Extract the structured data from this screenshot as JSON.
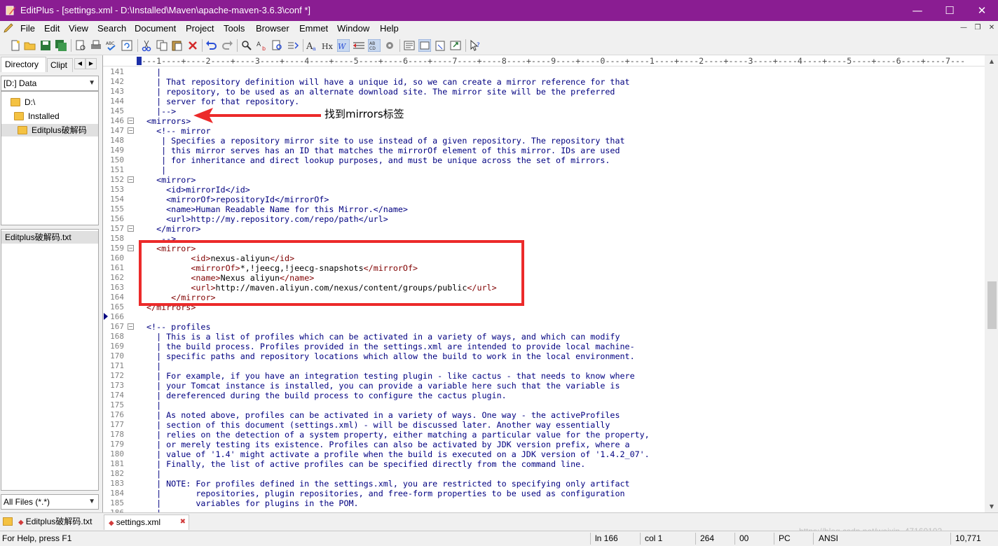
{
  "window": {
    "title": "EditPlus - [settings.xml - D:\\Installed\\Maven\\apache-maven-3.6.3\\conf *]",
    "minimize": "—",
    "maximize": "☐",
    "close": "✕"
  },
  "menu": [
    "File",
    "Edit",
    "View",
    "Search",
    "Document",
    "Project",
    "Tools",
    "Browser",
    "Emmet",
    "Window",
    "Help"
  ],
  "toolbar_icons": [
    "new-file-icon",
    "open-folder-icon",
    "save-icon",
    "save-all-icon",
    "print-preview-icon",
    "print-icon",
    "spell-check-icon",
    "refresh-icon",
    "cut-icon",
    "copy-icon",
    "paste-icon",
    "delete-icon",
    "undo-icon",
    "redo-icon",
    "find-icon",
    "replace-icon",
    "find-in-files-icon",
    "go-to-icon",
    "font-icon",
    "heading-icon",
    "word-wrap-icon",
    "ruler-icon",
    "line-number-icon",
    "settings-icon",
    "view-icon",
    "browser-icon",
    "clipboard-icon",
    "export-icon",
    "help-icon"
  ],
  "sidebar": {
    "tabs": [
      "Directory",
      "Clipt"
    ],
    "drive": "[D:] Data",
    "tree": [
      "D:\\",
      "Installed",
      "Editplus破解码"
    ],
    "files": [
      "Editplus破解码.txt"
    ],
    "filter": "All Files (*.*)"
  },
  "ruler": "+---1----+----2----+----3----+----4----+----5----+----6----+----7----+----8----+----9----+----0----+----1----+----2----+----3----+----4----+----5----+----6----+----7---",
  "code_lines": [
    {
      "n": "141",
      "parts": [
        [
          "t",
          "  |"
        ]
      ]
    },
    {
      "n": "142",
      "parts": [
        [
          "t",
          "  | That repository definition will have a unique id, so we can create a mirror reference for that"
        ]
      ]
    },
    {
      "n": "143",
      "parts": [
        [
          "t",
          "  | repository, to be used as an alternate download site. The mirror site will be the preferred"
        ]
      ]
    },
    {
      "n": "144",
      "parts": [
        [
          "t",
          "  | server for that repository."
        ]
      ]
    },
    {
      "n": "145",
      "parts": [
        [
          "t",
          "  |-->"
        ]
      ]
    },
    {
      "n": "146",
      "fold": true,
      "parts": [
        [
          "t",
          "<mirrors>"
        ]
      ]
    },
    {
      "n": "147",
      "fold": true,
      "parts": [
        [
          "t",
          "  <!-- mirror"
        ]
      ]
    },
    {
      "n": "148",
      "parts": [
        [
          "t",
          "   | Specifies a repository mirror site to use instead of a given repository. The repository that"
        ]
      ]
    },
    {
      "n": "149",
      "parts": [
        [
          "t",
          "   | this mirror serves has an ID that matches the mirrorOf element of this mirror. IDs are used"
        ]
      ]
    },
    {
      "n": "150",
      "parts": [
        [
          "t",
          "   | for inheritance and direct lookup purposes, and must be unique across the set of mirrors."
        ]
      ]
    },
    {
      "n": "151",
      "parts": [
        [
          "t",
          "   |"
        ]
      ]
    },
    {
      "n": "152",
      "fold": true,
      "parts": [
        [
          "t",
          "  <mirror>"
        ]
      ]
    },
    {
      "n": "153",
      "parts": [
        [
          "t",
          "    <id>mirrorId</id>"
        ]
      ]
    },
    {
      "n": "154",
      "parts": [
        [
          "t",
          "    <mirrorOf>repositoryId</mirrorOf>"
        ]
      ]
    },
    {
      "n": "155",
      "parts": [
        [
          "t",
          "    <name>Human Readable Name for this Mirror.</name>"
        ]
      ]
    },
    {
      "n": "156",
      "parts": [
        [
          "t",
          "    <url>http://my.repository.com/repo/path</url>"
        ]
      ]
    },
    {
      "n": "157",
      "fold": true,
      "parts": [
        [
          "t",
          "  </mirror>"
        ]
      ]
    },
    {
      "n": "158",
      "parts": [
        [
          "t",
          "   -->"
        ]
      ]
    },
    {
      "n": "159",
      "fold": true,
      "parts": [
        [
          "g",
          "  <mirror>"
        ]
      ]
    },
    {
      "n": "160",
      "parts": [
        [
          "g",
          "         <id>"
        ],
        [
          "x",
          "nexus-aliyun"
        ],
        [
          "g",
          "</id>"
        ]
      ]
    },
    {
      "n": "161",
      "parts": [
        [
          "g",
          "         <mirrorOf>"
        ],
        [
          "x",
          "*,!jeecg,!jeecg-snapshots"
        ],
        [
          "g",
          "</mirrorOf>"
        ]
      ]
    },
    {
      "n": "162",
      "parts": [
        [
          "g",
          "         <name>"
        ],
        [
          "x",
          "Nexus aliyun"
        ],
        [
          "g",
          "</name>"
        ]
      ]
    },
    {
      "n": "163",
      "parts": [
        [
          "g",
          "         <url>"
        ],
        [
          "x",
          "http://maven.aliyun.com/nexus/content/groups/public"
        ],
        [
          "g",
          "</url>"
        ]
      ]
    },
    {
      "n": "164",
      "parts": [
        [
          "g",
          "     </mirror>"
        ]
      ]
    },
    {
      "n": "165",
      "parts": [
        [
          "g",
          "</mirrors>"
        ]
      ]
    },
    {
      "n": "166",
      "parts": []
    },
    {
      "n": "167",
      "fold": true,
      "parts": [
        [
          "t",
          "<!-- profiles"
        ]
      ]
    },
    {
      "n": "168",
      "parts": [
        [
          "t",
          "  | This is a list of profiles which can be activated in a variety of ways, and which can modify"
        ]
      ]
    },
    {
      "n": "169",
      "parts": [
        [
          "t",
          "  | the build process. Profiles provided in the settings.xml are intended to provide local machine-"
        ]
      ]
    },
    {
      "n": "170",
      "parts": [
        [
          "t",
          "  | specific paths and repository locations which allow the build to work in the local environment."
        ]
      ]
    },
    {
      "n": "171",
      "parts": [
        [
          "t",
          "  |"
        ]
      ]
    },
    {
      "n": "172",
      "parts": [
        [
          "t",
          "  | For example, if you have an integration testing plugin - like cactus - that needs to know where"
        ]
      ]
    },
    {
      "n": "173",
      "parts": [
        [
          "t",
          "  | your Tomcat instance is installed, you can provide a variable here such that the variable is"
        ]
      ]
    },
    {
      "n": "174",
      "parts": [
        [
          "t",
          "  | dereferenced during the build process to configure the cactus plugin."
        ]
      ]
    },
    {
      "n": "175",
      "parts": [
        [
          "t",
          "  |"
        ]
      ]
    },
    {
      "n": "176",
      "parts": [
        [
          "t",
          "  | As noted above, profiles can be activated in a variety of ways. One way - the activeProfiles"
        ]
      ]
    },
    {
      "n": "177",
      "parts": [
        [
          "t",
          "  | section of this document (settings.xml) - will be discussed later. Another way essentially"
        ]
      ]
    },
    {
      "n": "178",
      "parts": [
        [
          "t",
          "  | relies on the detection of a system property, either matching a particular value for the property,"
        ]
      ]
    },
    {
      "n": "179",
      "parts": [
        [
          "t",
          "  | or merely testing its existence. Profiles can also be activated by JDK version prefix, where a"
        ]
      ]
    },
    {
      "n": "180",
      "parts": [
        [
          "t",
          "  | value of '1.4' might activate a profile when the build is executed on a JDK version of '1.4.2_07'."
        ]
      ]
    },
    {
      "n": "181",
      "parts": [
        [
          "t",
          "  | Finally, the list of active profiles can be specified directly from the command line."
        ]
      ]
    },
    {
      "n": "182",
      "parts": [
        [
          "t",
          "  |"
        ]
      ]
    },
    {
      "n": "183",
      "parts": [
        [
          "t",
          "  | NOTE: For profiles defined in the settings.xml, you are restricted to specifying only artifact"
        ]
      ]
    },
    {
      "n": "184",
      "parts": [
        [
          "t",
          "  |       repositories, plugin repositories, and free-form properties to be used as configuration"
        ]
      ]
    },
    {
      "n": "185",
      "parts": [
        [
          "t",
          "  |       variables for plugins in the POM."
        ]
      ]
    },
    {
      "n": "186",
      "parts": [
        [
          "t",
          "  |"
        ]
      ]
    }
  ],
  "annotation": {
    "label": "找到mirrors标签",
    "color": "#ec2a2a"
  },
  "file_tabs": [
    {
      "label": "Editplus破解码.txt",
      "active": false
    },
    {
      "label": "settings.xml",
      "active": true
    }
  ],
  "status": {
    "help": "For Help, press F1",
    "line": "ln 166",
    "col": "col 1",
    "chars": "264",
    "hex": "00",
    "eol": "PC",
    "encoding": "ANSI",
    "size": "10,771"
  },
  "watermark": "https://blog.csdn.net/weixin_47160102",
  "colors": {
    "titlebar": "#8a1d92",
    "code_comment": "#000080",
    "code_tag": "#800000",
    "highlight_box": "#ec2a2a"
  }
}
